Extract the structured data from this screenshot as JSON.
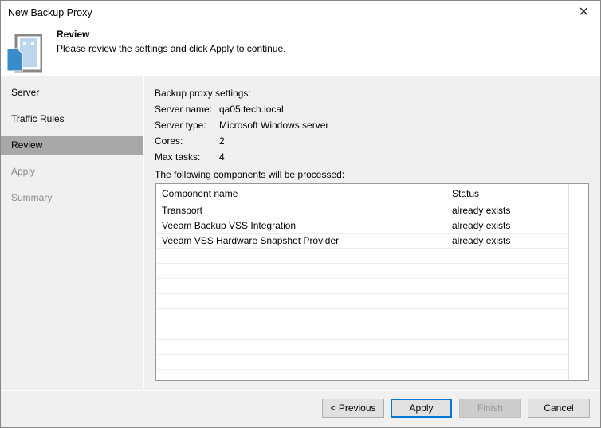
{
  "window": {
    "title": "New Backup Proxy",
    "close": "✕"
  },
  "header": {
    "title": "Review",
    "subtitle": "Please review the settings and click Apply to continue."
  },
  "steps": [
    {
      "label": "Server"
    },
    {
      "label": "Traffic Rules"
    },
    {
      "label": "Review"
    },
    {
      "label": "Apply"
    },
    {
      "label": "Summary"
    }
  ],
  "settings": {
    "heading": "Backup proxy settings:",
    "rows": [
      {
        "label": "Server name:",
        "value": "qa05.tech.local"
      },
      {
        "label": "Server type:",
        "value": "Microsoft Windows server"
      },
      {
        "label": "Cores:",
        "value": "2"
      },
      {
        "label": "Max tasks:",
        "value": "4"
      }
    ],
    "components_heading": "The following components will be processed:"
  },
  "table": {
    "headers": [
      "Component name",
      "Status"
    ],
    "rows": [
      {
        "name": "Transport",
        "status": "already exists"
      },
      {
        "name": "Veeam Backup VSS Integration",
        "status": "already exists"
      },
      {
        "name": "Veeam VSS Hardware Snapshot Provider",
        "status": "already exists"
      }
    ]
  },
  "buttons": {
    "previous": "< Previous",
    "apply": "Apply",
    "finish": "Finish",
    "cancel": "Cancel"
  }
}
